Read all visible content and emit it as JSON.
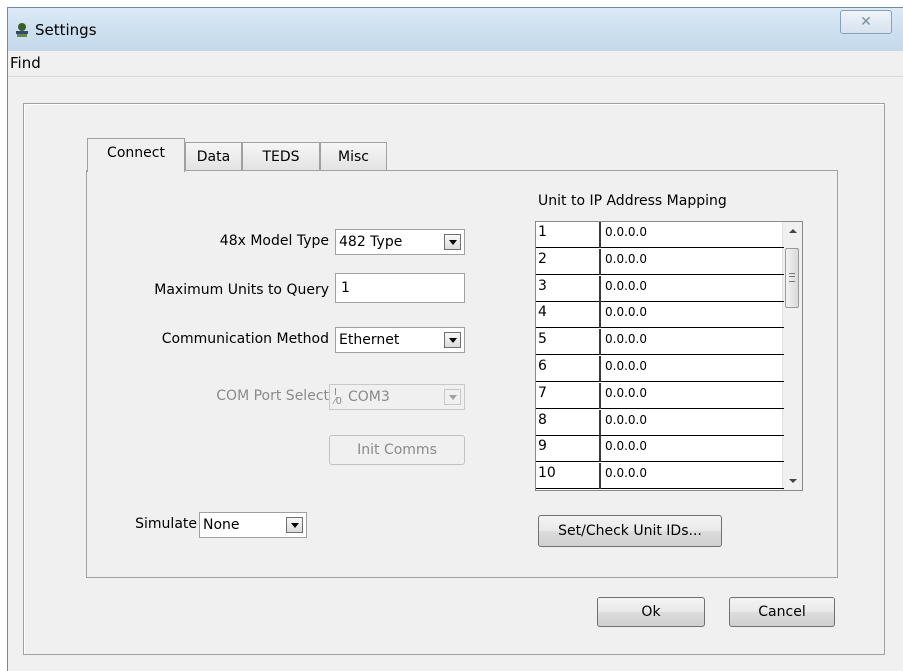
{
  "window": {
    "title": "Settings",
    "close_glyph": "✕"
  },
  "menu": {
    "find_label": "Find"
  },
  "tabs": [
    {
      "label": "Connect",
      "active": true
    },
    {
      "label": "Data",
      "active": false
    },
    {
      "label": "TEDS",
      "active": false
    },
    {
      "label": "Misc",
      "active": false
    }
  ],
  "connect": {
    "model_type_label": "48x Model Type",
    "model_type_value": "482 Type",
    "max_units_label": "Maximum Units to Query",
    "max_units_value": "1",
    "comm_method_label": "Communication Method",
    "comm_method_value": "Ethernet",
    "com_port_label": "COM Port Select",
    "com_port_value": "COM3",
    "init_comms_label": "Init Comms",
    "simulate_label": "Simulate",
    "simulate_value": "None"
  },
  "mapping": {
    "title": "Unit to IP Address Mapping",
    "rows": [
      {
        "unit": "1",
        "ip": "0.0.0.0"
      },
      {
        "unit": "2",
        "ip": "0.0.0.0"
      },
      {
        "unit": "3",
        "ip": "0.0.0.0"
      },
      {
        "unit": "4",
        "ip": "0.0.0.0"
      },
      {
        "unit": "5",
        "ip": "0.0.0.0"
      },
      {
        "unit": "6",
        "ip": "0.0.0.0"
      },
      {
        "unit": "7",
        "ip": "0.0.0.0"
      },
      {
        "unit": "8",
        "ip": "0.0.0.0"
      },
      {
        "unit": "9",
        "ip": "0.0.0.0"
      },
      {
        "unit": "10",
        "ip": "0.0.0.0"
      }
    ],
    "set_check_label": "Set/Check Unit IDs..."
  },
  "footer": {
    "ok_label": "Ok",
    "cancel_label": "Cancel"
  }
}
